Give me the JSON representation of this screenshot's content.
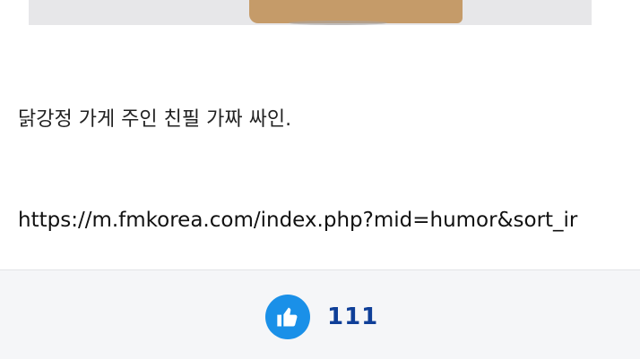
{
  "post": {
    "caption": "닭강정 가게 주인 친필 가짜 싸인.",
    "link": "https://m.fmkorea.com/index.php?mid=humor&sort_ir"
  },
  "vote": {
    "icon": "thumbs-up-icon",
    "count": "111",
    "accent_color": "#1a90e8",
    "count_color": "#0f3f98"
  }
}
